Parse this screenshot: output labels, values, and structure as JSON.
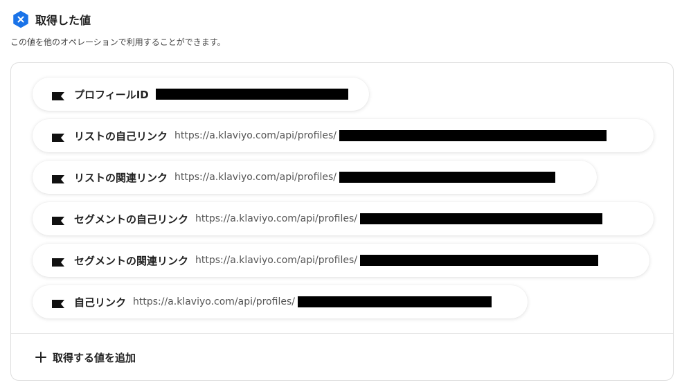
{
  "header": {
    "icon": "close-x-badge-icon",
    "title": "取得した値",
    "accent_color": "#1a73e8"
  },
  "description": "この値を他のオペレーションで利用することができます。",
  "items": [
    {
      "label": "プロフィールID",
      "url": ""
    },
    {
      "label": "リストの自己リンク",
      "url": "https://a.klaviyo.com/api/profiles/"
    },
    {
      "label": "リストの関連リンク",
      "url": "https://a.klaviyo.com/api/profiles/"
    },
    {
      "label": "セグメントの自己リンク",
      "url": "https://a.klaviyo.com/api/profiles/"
    },
    {
      "label": "セグメントの関連リンク",
      "url": "https://a.klaviyo.com/api/profiles/"
    },
    {
      "label": "自己リンク",
      "url": "https://a.klaviyo.com/api/profiles/"
    }
  ],
  "add_button": {
    "icon": "plus-icon",
    "label": "取得する値を追加"
  }
}
